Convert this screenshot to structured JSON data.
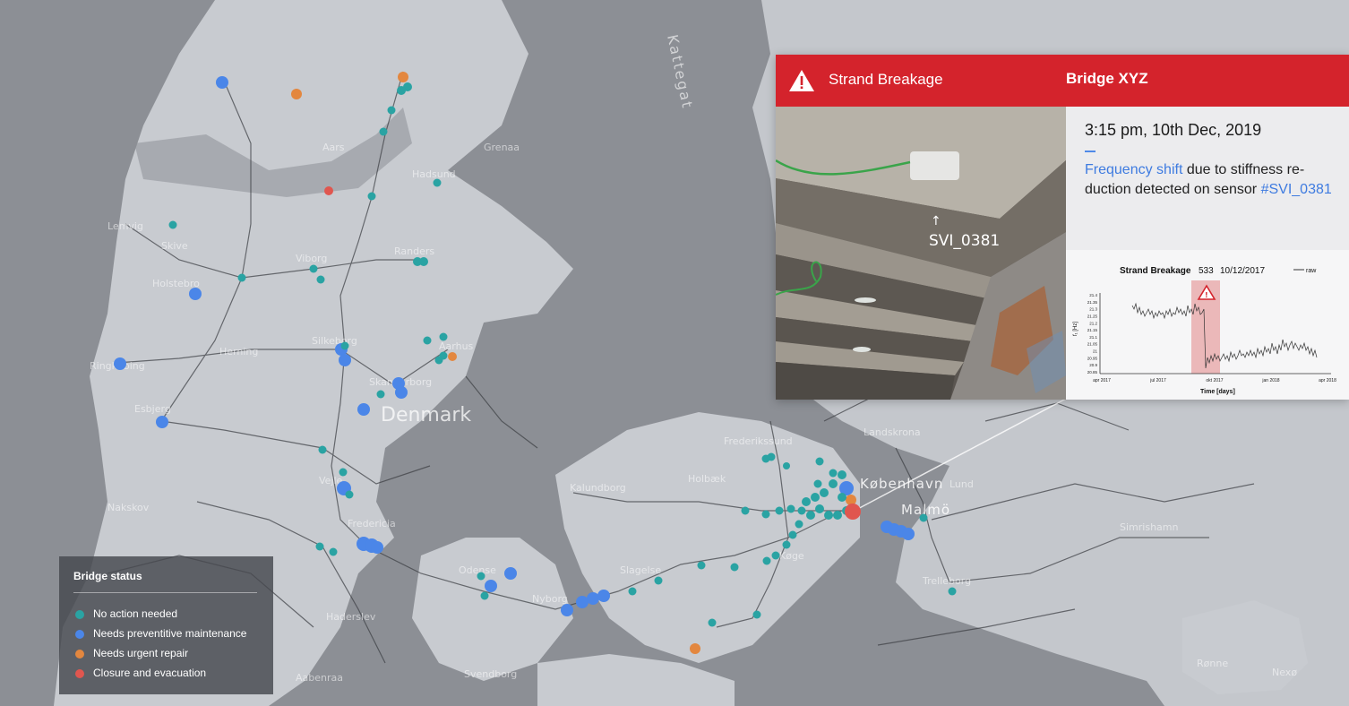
{
  "colors": {
    "no_action": "#2aa3a3",
    "preventive": "#4b86e8",
    "urgent": "#e3873f",
    "closure": "#e0564f",
    "alert_red": "#d4232c",
    "highlight_blue": "#3e7be0"
  },
  "map": {
    "country_label": "Denmark",
    "sea_label": "Kattegat",
    "place_labels": [
      "Aars",
      "Hadsund",
      "Viborg",
      "Randers",
      "Skive",
      "Holstebro",
      "Silkeborg",
      "Aarhus",
      "Herning",
      "Skanderborg",
      "Vejle",
      "Fredericia",
      "Odense",
      "Nyborg",
      "Slagelse",
      "Kalundborg",
      "Holbæk",
      "Frederikssund",
      "Landskrona",
      "Lund",
      "Malmö",
      "Simrishamn",
      "Trelleborg",
      "Svendborg",
      "Rønne",
      "Nexø",
      "Esbjerg",
      "Ringkøbing",
      "Lemvig",
      "Haderslev",
      "Aabenraa",
      "Grenaa",
      "Køge",
      "Nakskov"
    ],
    "city_label": "København"
  },
  "alert": {
    "icon": "warning-triangle-icon",
    "type": "Strand Breakage",
    "bridge": "Bridge XYZ",
    "timestamp": "3:15 pm, 10th Dec, 2019",
    "desc_highlight": "Frequency shift",
    "desc_mid": " due to stiffness re-duction detected on sensor ",
    "desc_sensor": "#SVI_0381",
    "photo_arrow": "↑",
    "photo_sensor_label": "SVI_0381"
  },
  "mini_chart": {
    "title": "Strand Breakage",
    "id": "533",
    "date": "10/12/2017",
    "legend_label": "raw",
    "xlabel": "Time [days]",
    "ylabel": "f₁ [Hz]",
    "x_ticks": [
      "apr 2017",
      "jul 2017",
      "okt 2017",
      "jan 2018",
      "apr 2018"
    ],
    "y_ticks": [
      "21.4",
      "21.35",
      "21.3",
      "21.25",
      "21.2",
      "21.15",
      "21.1",
      "21.05",
      "21",
      "20.95",
      "20.9",
      "20.85"
    ]
  },
  "legend": {
    "title": "Bridge status",
    "items": [
      {
        "label": "No action needed",
        "color": "#2aa3a3"
      },
      {
        "label": "Needs preventitive maintenance",
        "color": "#4b86e8"
      },
      {
        "label": "Needs urgent repair",
        "color": "#e3873f"
      },
      {
        "label": "Closure and evacuation",
        "color": "#e0564f"
      }
    ]
  }
}
